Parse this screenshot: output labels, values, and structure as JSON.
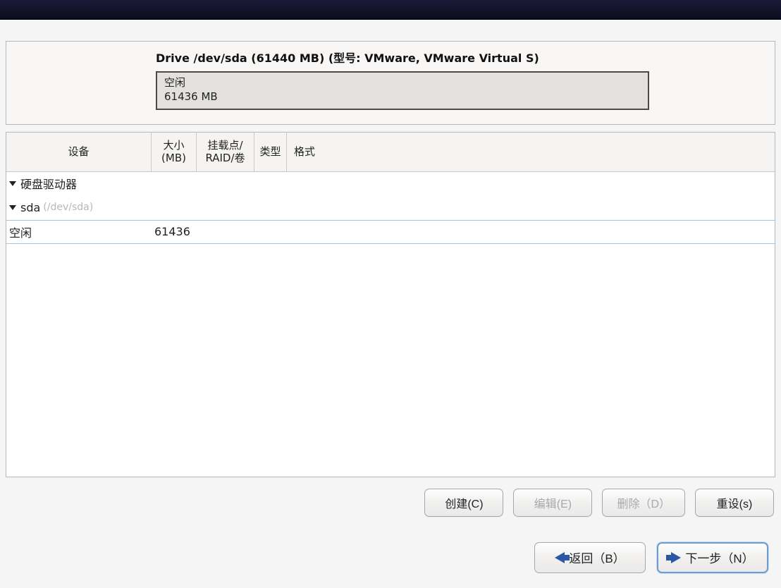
{
  "drive": {
    "title": "Drive /dev/sda (61440 MB) (型号: VMware, VMware Virtual S)",
    "free_label": "空闲",
    "free_size": "61436 MB"
  },
  "columns": {
    "device": "设备",
    "size": "大小\n(MB)",
    "mount": "挂载点/\nRAID/卷",
    "type": "类型",
    "format": "格式"
  },
  "tree": {
    "root_label": "硬盘驱动器",
    "disk_label": "sda",
    "disk_path": "(/dev/sda)",
    "free_row": {
      "label": "空闲",
      "size": "61436"
    }
  },
  "actions": {
    "create": "创建(C)",
    "edit": "编辑(E)",
    "delete": "删除（D）",
    "reset": "重设(s)"
  },
  "nav": {
    "back": "返回（B）",
    "next": "下一步（N）"
  }
}
